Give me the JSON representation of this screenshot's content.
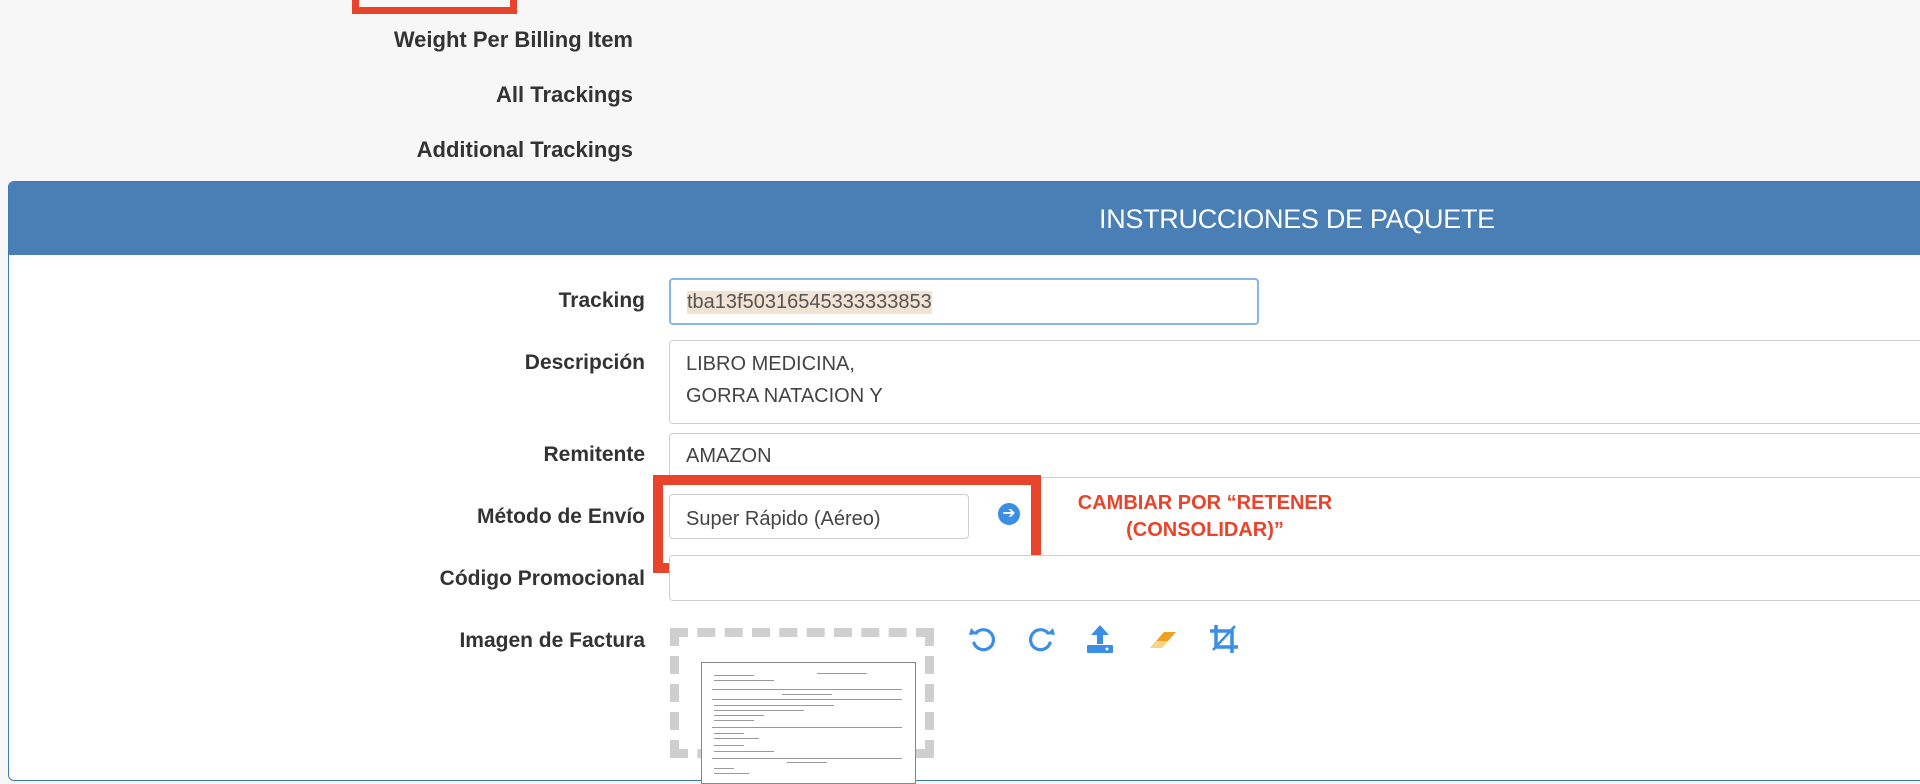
{
  "top_section": {
    "labels": [
      "Weight Per Billing Item",
      "All Trackings",
      "Additional Trackings"
    ]
  },
  "panel": {
    "title": "INSTRUCCIONES DE PAQUETE",
    "fields": {
      "tracking": {
        "label": "Tracking",
        "value": "tba13f5031654533333385​3"
      },
      "descripcion": {
        "label": "Descripción",
        "value_line1": "LIBRO MEDICINA,",
        "value_line2": "GORRA NATACION Y"
      },
      "remitente": {
        "label": "Remitente",
        "value": "AMAZON"
      },
      "metodo_envio": {
        "label": "Método de Envío",
        "value": "Super Rápido (Aéreo)"
      },
      "codigo_promocional": {
        "label": "Código Promocional",
        "value": ""
      },
      "imagen_factura": {
        "label": "Imagen de Factura"
      }
    },
    "annotation": {
      "line1": "CAMBIAR POR “RETENER",
      "line2": "(CONSOLIDAR)”"
    },
    "image_tools": [
      "rotate-left-icon",
      "rotate-right-icon",
      "upload-icon",
      "eraser-icon",
      "crop-icon"
    ]
  },
  "colors": {
    "header_bg": "#4a7fb5",
    "annotation_red": "#e8442b",
    "icon_blue": "#3a8ee6",
    "eraser_orange": "#f0a020"
  }
}
